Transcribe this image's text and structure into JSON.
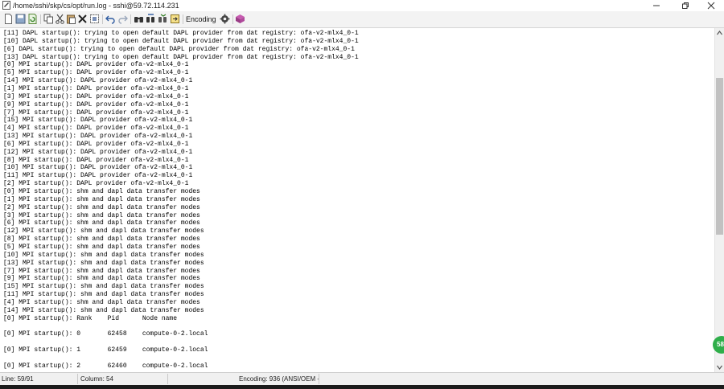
{
  "window": {
    "title": "/home/sshi/skp/cs/opt/run.log - sshi@59.72.114.231",
    "controls": {
      "minimize_icon": "minimize-icon",
      "restore_icon": "restore-icon",
      "close_icon": "close-icon"
    }
  },
  "toolbar": {
    "encoding_label": "Encoding",
    "icons": [
      "new-file-icon",
      "save-icon",
      "refresh-icon",
      "copy-icon",
      "cut-icon",
      "paste-icon",
      "delete-icon",
      "select-all-icon",
      "undo-icon",
      "redo-icon",
      "find-icon",
      "find-replace-icon",
      "find-next-icon",
      "goto-icon",
      "open-file-icon",
      "settings-icon",
      "plugin-icon"
    ]
  },
  "log_lines": [
    "[11] DAPL startup(): trying to open default DAPL provider from dat registry: ofa-v2-mlx4_0-1",
    "[10] DAPL startup(): trying to open default DAPL provider from dat registry: ofa-v2-mlx4_0-1",
    "[6] DAPL startup(): trying to open default DAPL provider from dat registry: ofa-v2-mlx4_0-1",
    "[13] DAPL startup(): trying to open default DAPL provider from dat registry: ofa-v2-mlx4_0-1",
    "[0] MPI startup(): DAPL provider ofa-v2-mlx4_0-1",
    "[5] MPI startup(): DAPL provider ofa-v2-mlx4_0-1",
    "[14] MPI startup(): DAPL provider ofa-v2-mlx4_0-1",
    "[1] MPI startup(): DAPL provider ofa-v2-mlx4_0-1",
    "[3] MPI startup(): DAPL provider ofa-v2-mlx4_0-1",
    "[9] MPI startup(): DAPL provider ofa-v2-mlx4_0-1",
    "[7] MPI startup(): DAPL provider ofa-v2-mlx4_0-1",
    "[15] MPI startup(): DAPL provider ofa-v2-mlx4_0-1",
    "[4] MPI startup(): DAPL provider ofa-v2-mlx4_0-1",
    "[13] MPI startup(): DAPL provider ofa-v2-mlx4_0-1",
    "[6] MPI startup(): DAPL provider ofa-v2-mlx4_0-1",
    "[12] MPI startup(): DAPL provider ofa-v2-mlx4_0-1",
    "[8] MPI startup(): DAPL provider ofa-v2-mlx4_0-1",
    "[10] MPI startup(): DAPL provider ofa-v2-mlx4_0-1",
    "[11] MPI startup(): DAPL provider ofa-v2-mlx4_0-1",
    "[2] MPI startup(): DAPL provider ofa-v2-mlx4_0-1",
    "[0] MPI startup(): shm and dapl data transfer modes",
    "[1] MPI startup(): shm and dapl data transfer modes",
    "[2] MPI startup(): shm and dapl data transfer modes",
    "[3] MPI startup(): shm and dapl data transfer modes",
    "[6] MPI startup(): shm and dapl data transfer modes",
    "[12] MPI startup(): shm and dapl data transfer modes",
    "[8] MPI startup(): shm and dapl data transfer modes",
    "[5] MPI startup(): shm and dapl data transfer modes",
    "[10] MPI startup(): shm and dapl data transfer modes",
    "[13] MPI startup(): shm and dapl data transfer modes",
    "[7] MPI startup(): shm and dapl data transfer modes",
    "[9] MPI startup(): shm and dapl data transfer modes",
    "[15] MPI startup(): shm and dapl data transfer modes",
    "[11] MPI startup(): shm and dapl data transfer modes",
    "[4] MPI startup(): shm and dapl data transfer modes",
    "[14] MPI startup(): shm and dapl data transfer modes",
    "[0] MPI startup(): Rank    Pid      Node name",
    "",
    "[0] MPI startup(): 0       62458    compute-0-2.local",
    "",
    "[0] MPI startup(): 1       62459    compute-0-2.local",
    "",
    "[0] MPI startup(): 2       62460    compute-0-2.local"
  ],
  "status": {
    "line": "Line: 59/91",
    "column": "Column: 54",
    "encoding": "Encoding: 936  (ANSI/OEM -"
  },
  "floating_badge": "58",
  "colors": {
    "toolbar_bg": "#f3f3f3",
    "statusbar_bg": "#f0f0f0",
    "scroll_thumb": "#c1c1c1",
    "badge": "#2fae4a"
  }
}
